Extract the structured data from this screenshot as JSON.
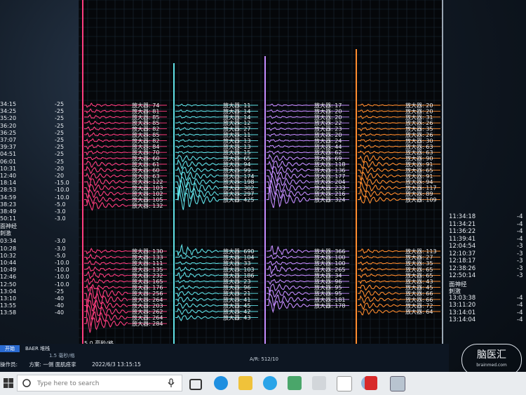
{
  "left_panel": {
    "upper": [
      {
        "time": "34:15",
        "value": "-25"
      },
      {
        "time": "34:25",
        "value": "-25"
      },
      {
        "time": "35:20",
        "value": "-25"
      },
      {
        "time": "36:20",
        "value": "-25"
      },
      {
        "time": "36:25",
        "value": "-25"
      },
      {
        "time": "37:07",
        "value": "-25"
      },
      {
        "time": "39:37",
        "value": "-25"
      },
      {
        "time": "04:51",
        "value": "-25"
      },
      {
        "time": "06:01",
        "value": "-25"
      },
      {
        "time": "10:31",
        "value": "-20"
      },
      {
        "time": "12:40",
        "value": "-20"
      },
      {
        "time": "18:14",
        "value": "-15.0"
      },
      {
        "time": "28:53",
        "value": "-10.0"
      },
      {
        "time": "34:59",
        "value": "-10.0"
      },
      {
        "time": "38:23",
        "value": "-5.0"
      },
      {
        "time": "38:49",
        "value": "-3.0"
      },
      {
        "time": "50:11",
        "value": "-3.0"
      }
    ],
    "section_label": "面神经",
    "section_label2": "刺激",
    "lower": [
      {
        "time": "03:34",
        "value": "-3.0"
      },
      {
        "time": "10:28",
        "value": "-3.0"
      },
      {
        "time": "10:32",
        "value": "-5.0"
      },
      {
        "time": "10:44",
        "value": "-10.0"
      },
      {
        "time": "10:49",
        "value": "-10.0"
      },
      {
        "time": "12:46",
        "value": "-10.0"
      },
      {
        "time": "12:50",
        "value": "-10.0"
      },
      {
        "time": "13:04",
        "value": "-25"
      },
      {
        "time": "13:10",
        "value": "-40"
      },
      {
        "time": "13:55",
        "value": "-40"
      },
      {
        "time": "13:58",
        "value": "-40"
      }
    ]
  },
  "amplifier_prefix": "放大器:",
  "channels": [
    {
      "color": "#ff3d7f",
      "upper_values": [
        "74",
        "81",
        "85",
        "85",
        "82",
        "85",
        "82",
        "84",
        "70",
        "60",
        "61",
        "60",
        "63",
        "122",
        "103",
        "102",
        "105",
        "132"
      ],
      "lower_values": [
        "130",
        "133",
        "111",
        "135",
        "232",
        "165",
        "176",
        "256",
        "264",
        "203",
        "262",
        "264",
        "284"
      ]
    },
    {
      "color": "#5fe0e6",
      "upper_values": [
        "11",
        "14",
        "14",
        "12",
        "27",
        "11",
        "13",
        "13",
        "15",
        "65",
        "94",
        "99",
        "174",
        "198",
        "302",
        "297",
        "425"
      ],
      "lower_values": [
        "690",
        "104",
        "33",
        "103",
        "186",
        "23",
        "96",
        "21",
        "41",
        "45",
        "42",
        "43"
      ]
    },
    {
      "color": "#c48cff",
      "upper_values": [
        "17",
        "20",
        "20",
        "22",
        "23",
        "20",
        "24",
        "44",
        "62",
        "69",
        "118",
        "136",
        "177",
        "204",
        "233",
        "216",
        "324"
      ],
      "lower_values": [
        "366",
        "100",
        "100",
        "265",
        "34",
        "96",
        "95",
        "95",
        "181",
        "178"
      ]
    },
    {
      "color": "#ff8c2e",
      "upper_values": [
        "20",
        "20",
        "31",
        "26",
        "35",
        "26",
        "30",
        "63",
        "63",
        "90",
        "91",
        "65",
        "91",
        "94",
        "117",
        "89",
        "109"
      ],
      "lower_values": [
        "113",
        "27",
        "35",
        "65",
        "65",
        "43",
        "45",
        "66",
        "66",
        "72",
        "64"
      ]
    }
  ],
  "right_panel": {
    "upper": [
      {
        "time": "11:34:18",
        "value": "-4"
      },
      {
        "time": "11:34:21",
        "value": "-4"
      },
      {
        "time": "11:36:22",
        "value": "-4"
      },
      {
        "time": "11:39:41",
        "value": "-4"
      },
      {
        "time": "12:04:54",
        "value": "-3"
      },
      {
        "time": "12:10:37",
        "value": "-3"
      },
      {
        "time": "12:18:17",
        "value": "-3"
      },
      {
        "time": "12:38:26",
        "value": "-3"
      },
      {
        "time": "12:50:14",
        "value": "-3"
      }
    ],
    "section_label": "面神经",
    "section_label2": "刺激",
    "lower": [
      {
        "time": "13:03:38",
        "value": "-4"
      },
      {
        "time": "13:11:20",
        "value": "-4"
      },
      {
        "time": "13:14:01",
        "value": "-4"
      },
      {
        "time": "13:14:04",
        "value": "-4"
      }
    ]
  },
  "status": {
    "start_label": "开始",
    "mode_label": "BAER 堆栈",
    "hint": "1.5 毫秒/格",
    "operator_prefix": "操作员:",
    "scheme": "方案: 一侧  面肌痉挛",
    "datetime": "2022/6/3 13:15:15",
    "scale_label": "5.0 毫秒/格",
    "ar_readout": "A/R: 512/10"
  },
  "taskbar": {
    "search_placeholder": "Type here to search"
  },
  "watermark": {
    "text": "脑医汇",
    "sub": "brainmed.com"
  }
}
